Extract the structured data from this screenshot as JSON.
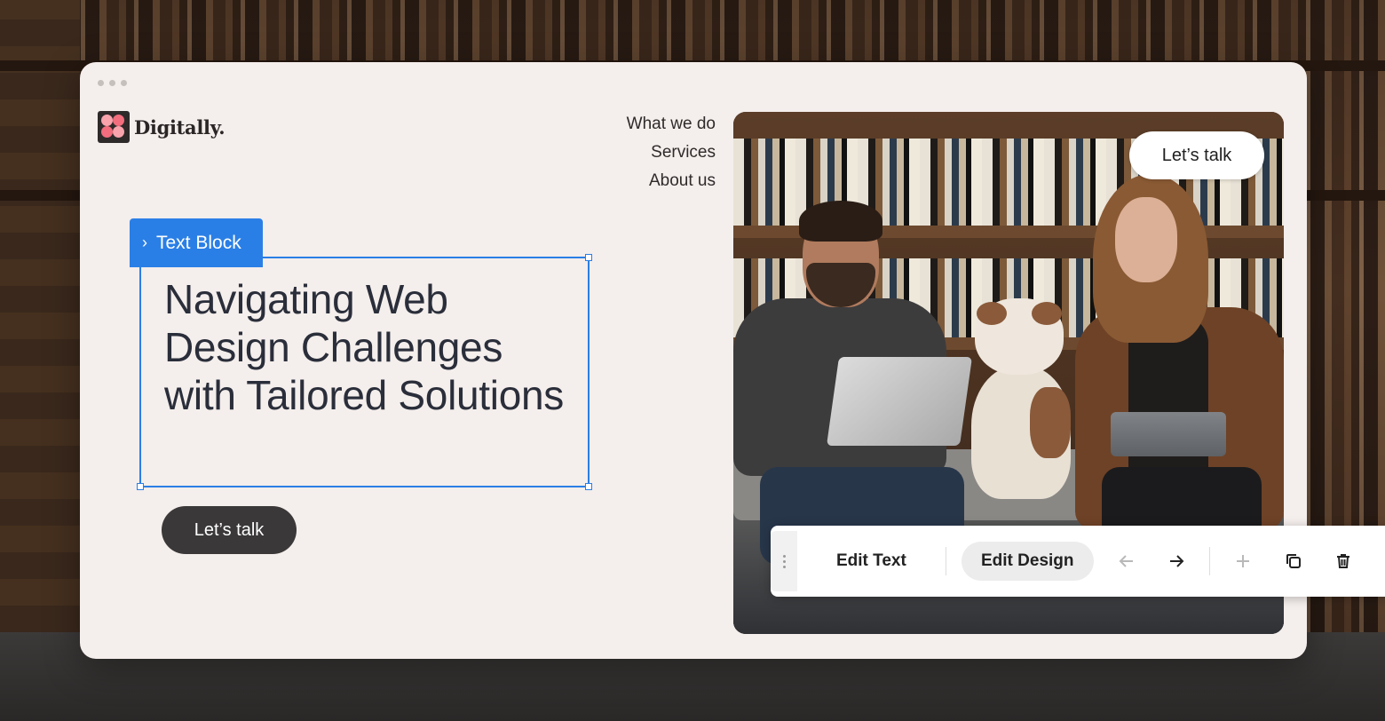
{
  "brand": {
    "name": "Digitally."
  },
  "nav": {
    "items": [
      "What we do",
      "Services",
      "About us"
    ]
  },
  "selection": {
    "tag_label": "Text Block"
  },
  "hero": {
    "headline": "Navigating Web Design Challenges with Tailored Solutions",
    "cta_label": "Let’s talk",
    "image_cta_label": "Let’s talk"
  },
  "toolbar": {
    "edit_text_label": "Edit Text",
    "edit_design_label": "Edit Design",
    "icons": [
      "drag-handle-icon",
      "arrow-left-icon",
      "arrow-right-icon",
      "plus-icon",
      "duplicate-icon",
      "trash-icon"
    ]
  },
  "colors": {
    "accent": "#2a7fe6",
    "cta": "#3a3838",
    "panel": "#f4eeec"
  }
}
